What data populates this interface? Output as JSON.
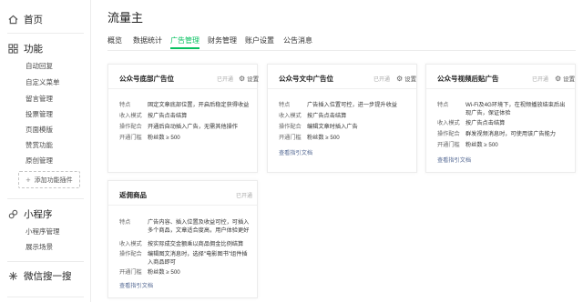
{
  "sidebar": {
    "home": {
      "label": "首页",
      "icon": "home-icon"
    },
    "features": {
      "label": "功能",
      "icon": "grid-icon",
      "items": [
        "自动回复",
        "自定义菜单",
        "留言管理",
        "投票管理",
        "页面模版",
        "赞赏功能",
        "原创管理"
      ],
      "add_plugin_label": "添加功能插件"
    },
    "miniprogram": {
      "label": "小程序",
      "icon": "link-icon",
      "items": [
        "小程序管理",
        "展示场景"
      ]
    },
    "search": {
      "label": "微信搜一搜",
      "icon": "sparkle-icon"
    }
  },
  "page": {
    "title": "流量主",
    "tabs": [
      "概览",
      "数据统计",
      "广告管理",
      "财务管理",
      "账户设置",
      "公告消息"
    ],
    "active_tab": "广告管理"
  },
  "cards": [
    {
      "title": "公众号底部广告位",
      "status": "已开通",
      "settings_label": "设置",
      "rows": [
        {
          "k": "特点",
          "v": "固定文章底部位置，开启后稳定获得收益"
        },
        {
          "k": "收入模式",
          "v": "按广告点击结算"
        },
        {
          "k": "操作配合",
          "v": "开通后自动插入广告，无需其他操作"
        },
        {
          "k": "开通门槛",
          "v": "粉丝数 ≥ 500"
        }
      ]
    },
    {
      "title": "公众号文中广告位",
      "status": "已开通",
      "settings_label": "设置",
      "rows": [
        {
          "k": "特点",
          "v": "广告插入位置可控，进一步提升收益"
        },
        {
          "k": "收入模式",
          "v": "按广告点击结算"
        },
        {
          "k": "操作配合",
          "v": "编辑文章时插入广告"
        },
        {
          "k": "开通门槛",
          "v": "粉丝数 ≥ 500"
        }
      ],
      "link": "查看指引文档"
    },
    {
      "title": "公众号视频后贴广告",
      "status": "已开通",
      "settings_label": "设置",
      "rows": [
        {
          "k": "特点",
          "v": "Wi-Fi及4G环境下，在视频播放结束后出现广告，保证体验"
        },
        {
          "k": "收入模式",
          "v": "按广告点击结算"
        },
        {
          "k": "操作配合",
          "v": "群发视频消息时，可使用该广告能力"
        },
        {
          "k": "开通门槛",
          "v": "粉丝数 ≥ 500"
        }
      ],
      "link": "查看指引文档"
    },
    {
      "title": "返佣商品",
      "status": "已开通",
      "rows": [
        {
          "k": "特点",
          "v": "广告内容、插入位置及收益可控，可插入多个商品，文章适合度高，用户体验更好"
        },
        {
          "k": "收入模式",
          "v": "按实际成交金额乘以商品佣金比例结算"
        },
        {
          "k": "操作配合",
          "v": "编辑图文消息时，选择\"电影图书\"组件插入商品即可"
        },
        {
          "k": "开通门槛",
          "v": "粉丝数 ≥ 500"
        }
      ],
      "link": "查看指引文档"
    }
  ],
  "colors": {
    "accent": "#07c160",
    "link": "#576b95"
  }
}
